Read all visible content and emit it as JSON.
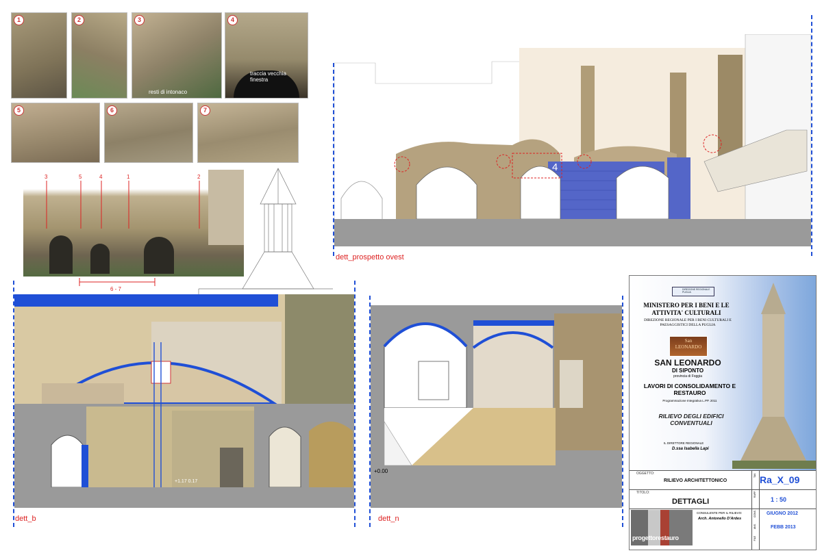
{
  "photos": [
    {
      "num": "1"
    },
    {
      "num": "2"
    },
    {
      "num": "3",
      "note": "resti di intonaco"
    },
    {
      "num": "4",
      "note": "traccia vecchia finestra"
    },
    {
      "num": "5"
    },
    {
      "num": "6"
    },
    {
      "num": "7"
    }
  ],
  "photo_markers": [
    "3",
    "5",
    "4",
    "1",
    "2"
  ],
  "range_label": "6 - 7",
  "drawings": {
    "prospetto_ovest": "dett_prospetto ovest",
    "dett_b": "dett_b",
    "dett_n": "dett_n",
    "level_label": "+0.00",
    "level_b": "+1.17  0.17",
    "elevation_markers": [
      "3",
      "5",
      "4",
      "1",
      "2"
    ]
  },
  "title_block": {
    "ministry_badge": "DIREZIONE REGIONALE PUGLIA",
    "ministry": "MINISTERO PER I BENI E LE ATTIVITA' CULTURALI",
    "direction": "DIREZIONE REGIONALE PER I BENI CULTURALI E PAESAGGISTICI DELLA PUGLIA",
    "logo_text": "San LEONARDO",
    "site": "SAN LEONARDO",
    "site_sub": "DI SIPONTO",
    "province": "provincia di Foggia",
    "works": "LAVORI DI CONSOLIDAMENTO E RESTAURO",
    "program_note": "Programmazione Integrativa L.PP. 2011",
    "subject": "RILIEVO DEGLI EDIFICI CONVENTUALI",
    "director_role": "IL DIRETTORE REGIONALE",
    "director": "D.ssa Isabella Lapi",
    "oggetto_label": "OGGETTO:",
    "oggetto": "RILIEVO ARCHITETTONICO",
    "titolo_label": "TITOLO:",
    "titolo": "DETTAGLI",
    "code": "Ra_X_09",
    "scale": "1 : 50",
    "date1": "GIUGNO 2012",
    "date2": "FEBB 2013",
    "consultant_role": "CONSULENTE PER IL RILIEVO:",
    "consultant": "Arch. Antonello D'Ardes",
    "firm": "progettorestauro",
    "side_labels": [
      "TAV.",
      "RAPP.",
      "CONS.",
      "ANS.",
      "FILE"
    ]
  },
  "colors": {
    "accent_blue": "#1f4fd6",
    "label_red": "#d22",
    "stone": "#b8a57e",
    "section_gray": "#9a9a9a"
  }
}
